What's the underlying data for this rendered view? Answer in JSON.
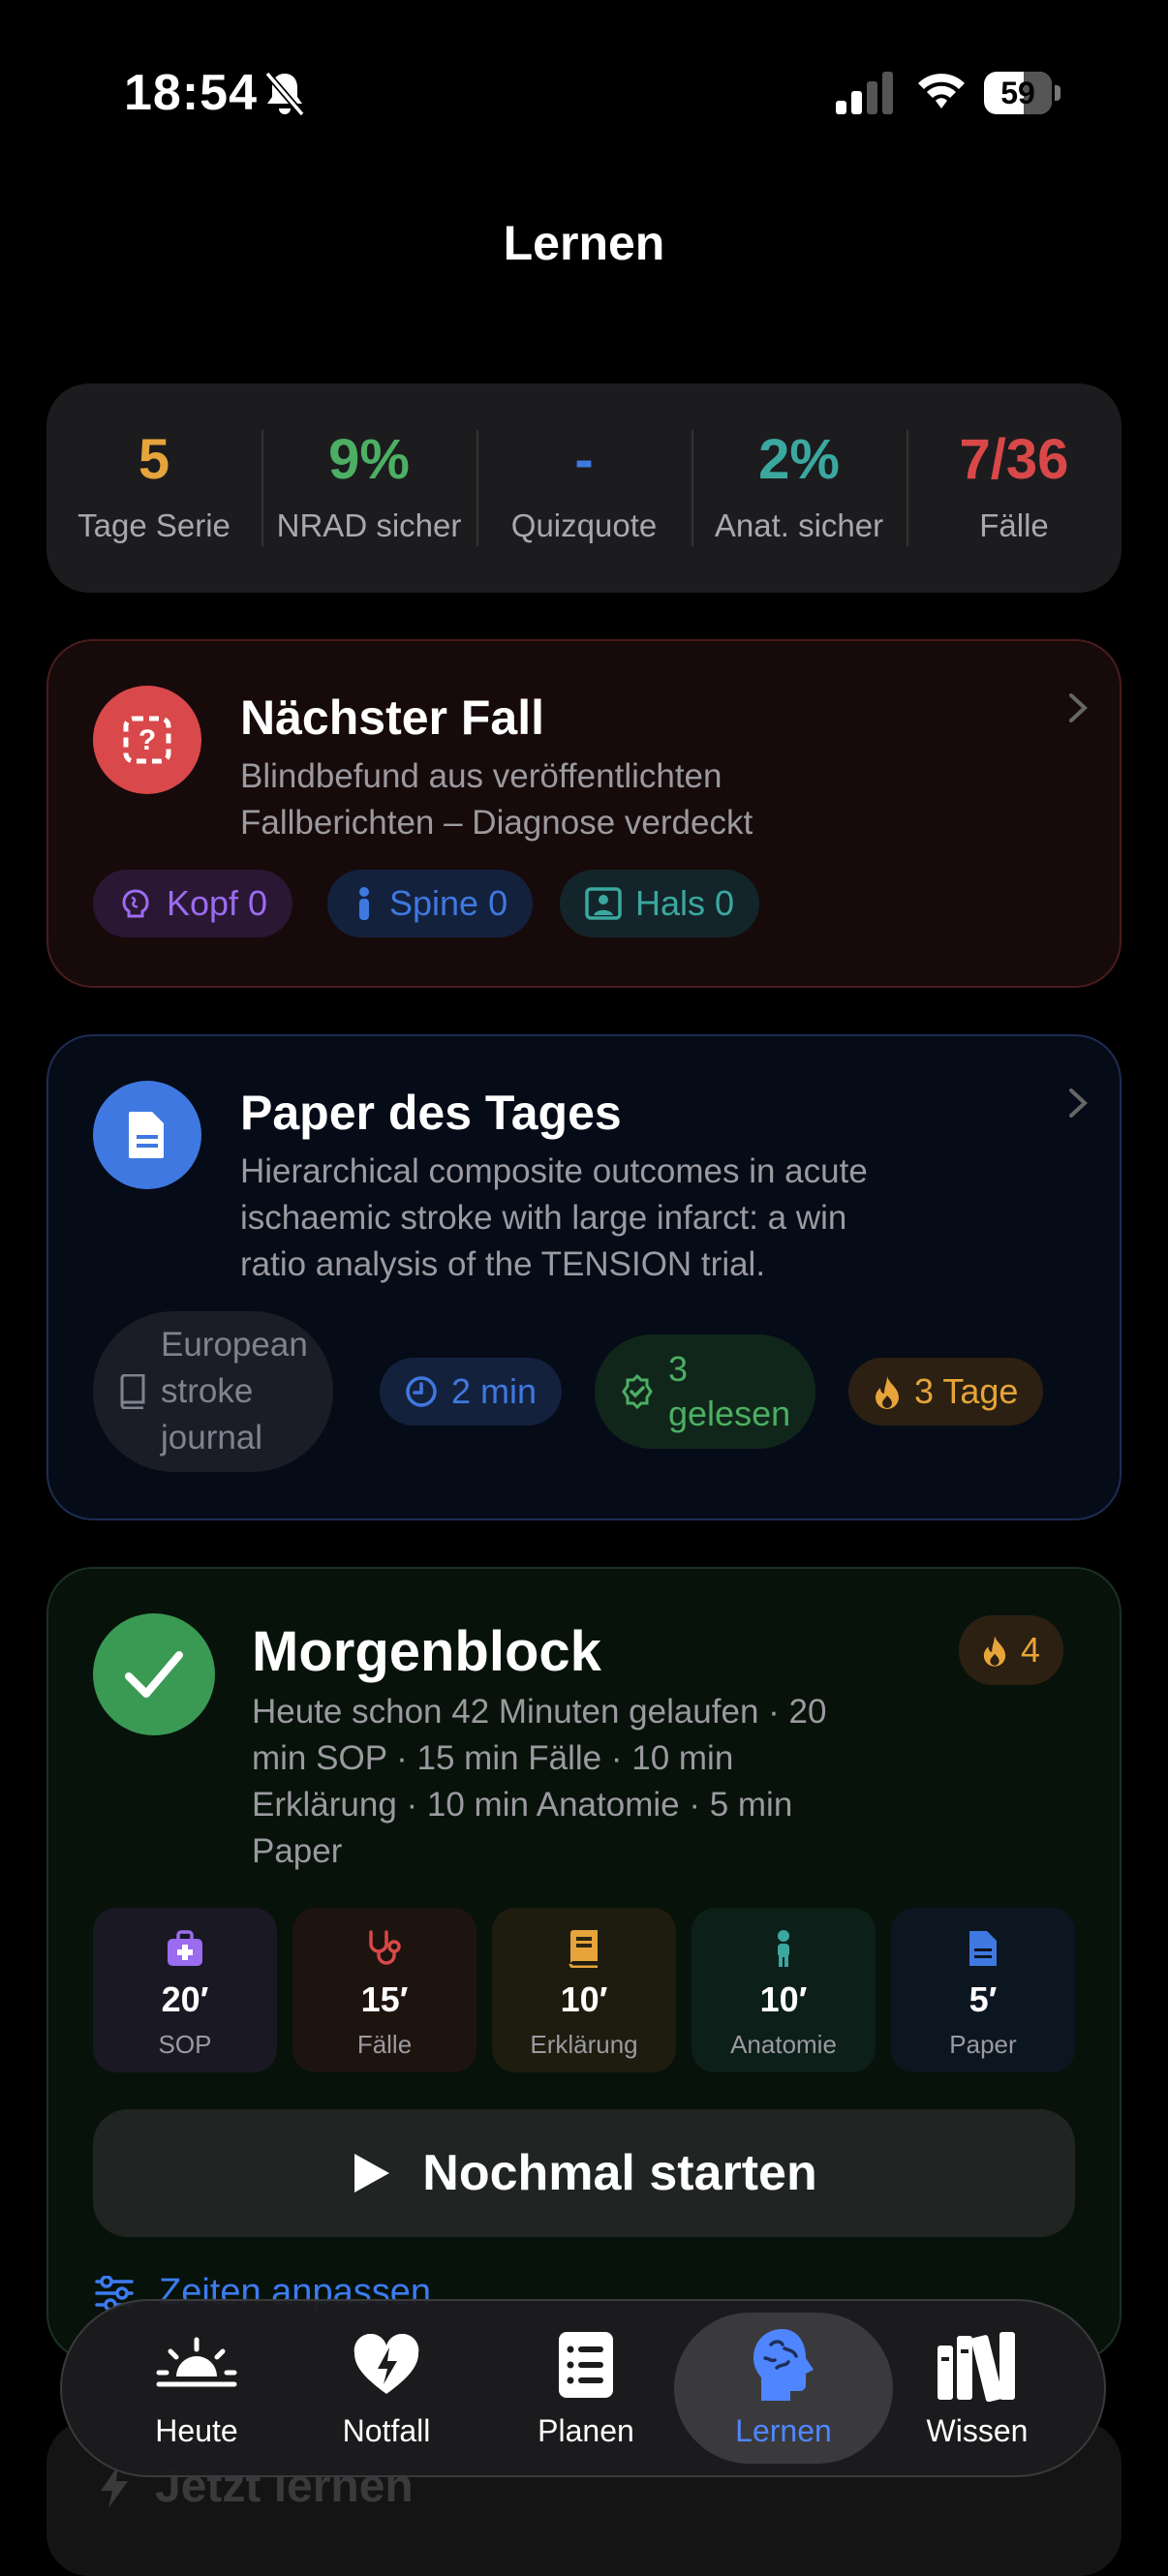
{
  "status_bar": {
    "time": "18:54",
    "battery": "59",
    "battery_level": 0.59
  },
  "nav": {
    "title": "Lernen"
  },
  "stats": [
    {
      "value": "5",
      "label": "Tage Serie",
      "color": "#e6a43a"
    },
    {
      "value": "9%",
      "label": "NRAD sicher",
      "color": "#4caf63"
    },
    {
      "value": "-",
      "label": "Quizquote",
      "color": "#3f78e0"
    },
    {
      "value": "2%",
      "label": "Anat. sicher",
      "color": "#3ba8a0"
    },
    {
      "value": "7/36",
      "label": "Fälle",
      "color": "#d94848"
    }
  ],
  "next_case": {
    "title": "Nächster Fall",
    "subtitle_line1": "Blindbefund aus veröffentlichten",
    "subtitle_line2": "Fallberichten – Diagnose verdeckt",
    "icon": "question-box-icon",
    "accent": "#d9484a",
    "tags": [
      {
        "label": "Kopf 0",
        "icon": "brain-icon",
        "color": "#9b6cf0"
      },
      {
        "label": "Spine 0",
        "icon": "person-icon",
        "color": "#3f78e0"
      },
      {
        "label": "Hals 0",
        "icon": "portrait-icon",
        "color": "#3ba8a0"
      }
    ]
  },
  "paper": {
    "title": "Paper des Tages",
    "subtitle_line1": "Hierarchical composite outcomes in acute",
    "subtitle_line2": "ischaemic stroke with large infarct: a win",
    "subtitle_line3": "ratio analysis of the TENSION trial.",
    "icon": "document-icon",
    "accent": "#3f78e0",
    "journal_line1": "European",
    "journal_line2": "stroke",
    "journal_line3": "journal",
    "duration": "2 min",
    "read_line1": "3",
    "read_line2": "gelesen",
    "streak": "3 Tage"
  },
  "morgenblock": {
    "title": "Morgenblock",
    "streak": "4",
    "desc_line1": "Heute schon 42 Minuten gelaufen · 20",
    "desc_line2": "min SOP · 15 min Fälle · 10 min",
    "desc_line3": "Erklärung · 10 min Anatomie · 5 min",
    "desc_line4": "Paper",
    "accent": "#3a9a54",
    "tiles": [
      {
        "value": "20′",
        "label": "SOP",
        "icon": "medkit-icon",
        "color": "#9b6cf0"
      },
      {
        "value": "15′",
        "label": "Fälle",
        "icon": "stethoscope-icon",
        "color": "#d94848"
      },
      {
        "value": "10′",
        "label": "Erklärung",
        "icon": "book-icon",
        "color": "#e6a43a"
      },
      {
        "value": "10′",
        "label": "Anatomie",
        "icon": "person-icon",
        "color": "#3ba8a0"
      },
      {
        "value": "5′",
        "label": "Paper",
        "icon": "document-icon",
        "color": "#3f78e0"
      }
    ],
    "start_label": "Nochmal starten",
    "adjust_label": "Zeiten anpassen"
  },
  "next_block": {
    "label": "Jetzt lernen"
  },
  "tabs": [
    {
      "label": "Heute",
      "icon": "sunrise-icon"
    },
    {
      "label": "Notfall",
      "icon": "heart-bolt-icon"
    },
    {
      "label": "Planen",
      "icon": "list-icon"
    },
    {
      "label": "Lernen",
      "icon": "brain-head-icon",
      "active": true
    },
    {
      "label": "Wissen",
      "icon": "books-icon"
    }
  ]
}
